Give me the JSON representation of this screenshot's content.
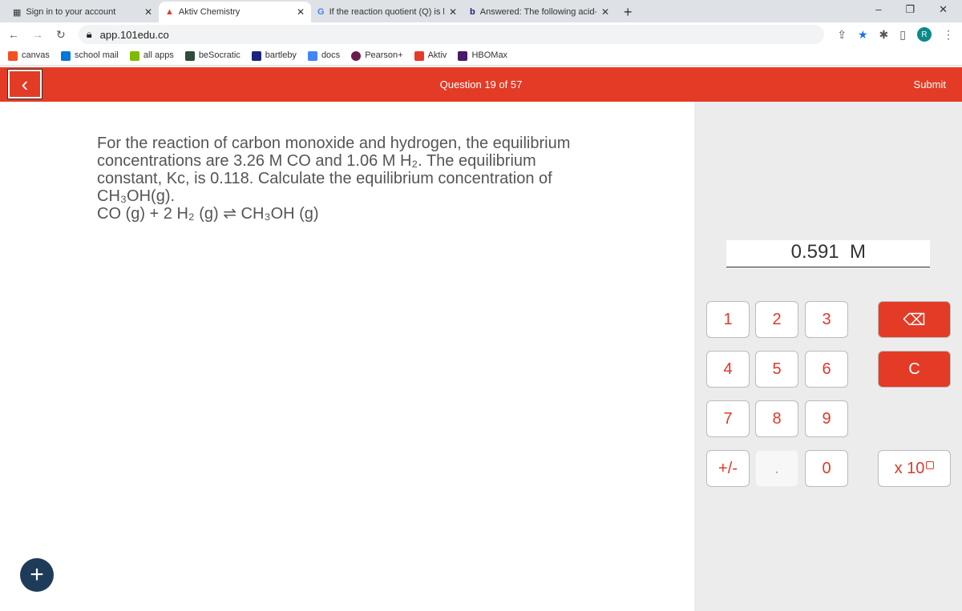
{
  "browser": {
    "tabs": [
      {
        "label": "Sign in to your account"
      },
      {
        "label": "Aktiv Chemistry"
      },
      {
        "label": "If the reaction quotient (Q) is larg"
      },
      {
        "label": "Answered: The following acid-ba"
      }
    ],
    "url": "app.101edu.co",
    "profile_initial": "R",
    "bookmarks": [
      "canvas",
      "school mail",
      "all apps",
      "beSocratic",
      "bartleby",
      "docs",
      "Pearson+",
      "Aktiv",
      "HBOMax"
    ]
  },
  "header": {
    "question_counter": "Question 19 of 57",
    "submit_label": "Submit",
    "accent": "#e33b26"
  },
  "question": {
    "text": "For the reaction of carbon monoxide and hydrogen, the equilibrium concentrations are 3.26 M CO and 1.06 M H₂. The equilibrium constant, Kc, is 0.118. Calculate the equilibrium concentration of CH₃OH(g).",
    "equation": "CO (g) + 2 H₂ (g) ⇌ CH₃OH (g)"
  },
  "answer": {
    "value": "0.591",
    "unit": "M"
  },
  "keypad": {
    "keys": [
      "1",
      "2",
      "3",
      "4",
      "5",
      "6",
      "7",
      "8",
      "9",
      "+/-",
      ".",
      "0"
    ],
    "clear": "C",
    "backspace": "⌫",
    "exponent": "x 10"
  }
}
